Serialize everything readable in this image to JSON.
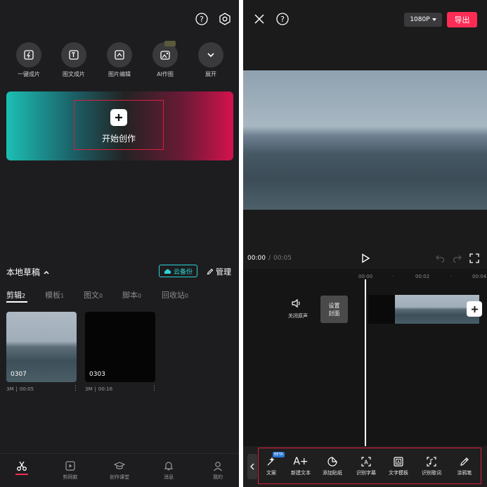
{
  "left": {
    "quick_actions": [
      {
        "label": "一键成片",
        "icon": "one-click-video-icon"
      },
      {
        "label": "图文成片",
        "icon": "text-to-video-icon"
      },
      {
        "label": "图片编辑",
        "icon": "image-edit-icon"
      },
      {
        "label": "AI作图",
        "icon": "ai-image-icon"
      },
      {
        "label": "展开",
        "icon": "chevron-down-icon"
      }
    ],
    "hero_label": "开始创作",
    "drafts_title": "本地草稿",
    "cloud_backup": "云备份",
    "manage": "管理",
    "tabs": [
      {
        "label": "剪辑",
        "count": "2"
      },
      {
        "label": "模板",
        "count": "1"
      },
      {
        "label": "图文",
        "count": "0"
      },
      {
        "label": "脚本",
        "count": "0"
      },
      {
        "label": "回收站",
        "count": "0"
      }
    ],
    "drafts": [
      {
        "name": "0307",
        "size": "3M",
        "duration": "00:05"
      },
      {
        "name": "0303",
        "size": "3M",
        "duration": "00:16"
      }
    ],
    "bottom_nav": [
      {
        "label": "",
        "icon": "scissors-icon"
      },
      {
        "label": "剪同款",
        "icon": "template-icon"
      },
      {
        "label": "创作课堂",
        "icon": "graduation-cap-icon"
      },
      {
        "label": "消息",
        "icon": "bell-icon"
      },
      {
        "label": "我的",
        "icon": "profile-icon"
      }
    ]
  },
  "right": {
    "resolution": "1080P",
    "export": "导出",
    "time_current": "00:00",
    "time_separator": "/",
    "time_total": "00:05",
    "ruler_marks": [
      "00:00",
      "·",
      "00:02",
      "·",
      "00:04"
    ],
    "mute_label": "关闭原声",
    "cover_label_line1": "设置",
    "cover_label_line2": "封面",
    "beta": "BETA",
    "tools": [
      {
        "label": "文案",
        "icon": "magic-pen-icon"
      },
      {
        "label": "新建文本",
        "icon": "new-text-icon"
      },
      {
        "label": "添加贴纸",
        "icon": "sticker-icon"
      },
      {
        "label": "识别字幕",
        "icon": "recognize-subtitle-icon"
      },
      {
        "label": "文字模板",
        "icon": "text-template-icon"
      },
      {
        "label": "识别歌词",
        "icon": "recognize-lyrics-icon"
      },
      {
        "label": "涂鸦笔",
        "icon": "brush-icon"
      }
    ]
  },
  "colors": {
    "accent": "#fe2c55",
    "highlight_box": "#d91f3c",
    "cloud": "#2ad4d4"
  }
}
